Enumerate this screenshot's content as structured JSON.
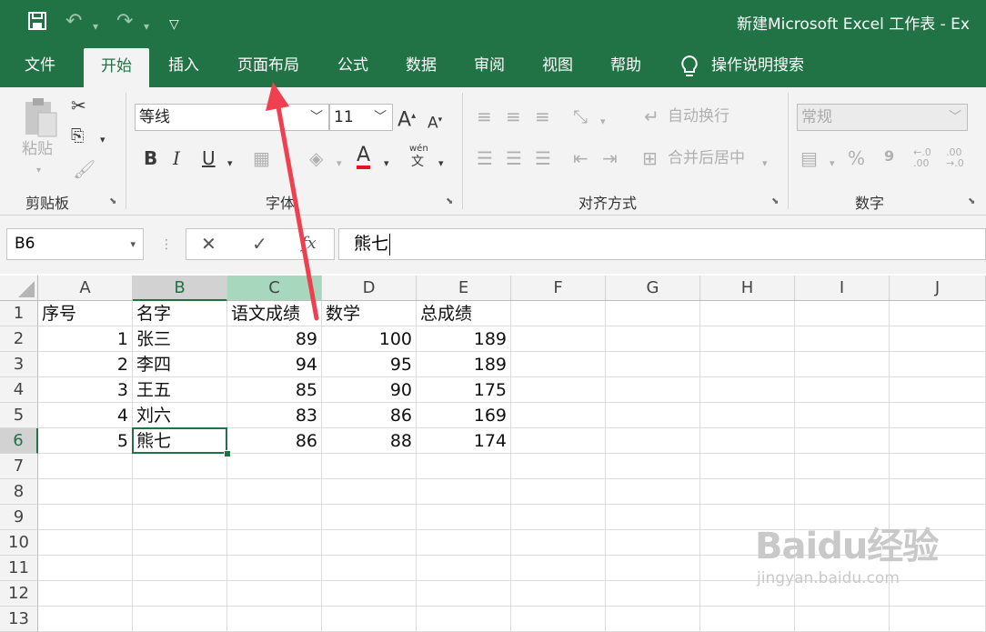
{
  "colors": {
    "accent": "#217346",
    "arrow": "#f04050"
  },
  "titlebar": {
    "save_icon": "save-icon",
    "undo_icon": "undo-icon",
    "redo_icon": "redo-icon",
    "customize_icon": "customize-quick-access-icon",
    "title": "新建Microsoft Excel 工作表  -  Ex"
  },
  "tabs": [
    {
      "label": "文件"
    },
    {
      "label": "开始",
      "active": true
    },
    {
      "label": "插入"
    },
    {
      "label": "页面布局"
    },
    {
      "label": "公式"
    },
    {
      "label": "数据"
    },
    {
      "label": "审阅"
    },
    {
      "label": "视图"
    },
    {
      "label": "帮助"
    }
  ],
  "tell_me": {
    "label": "操作说明搜索",
    "icon": "lightbulb-icon"
  },
  "ribbon": {
    "clipboard": {
      "label": "剪贴板",
      "paste": "粘贴"
    },
    "font": {
      "label": "字体",
      "font_name": "等线",
      "font_size": "11",
      "bold": "B",
      "italic": "I",
      "underline": "U",
      "font_color": "A",
      "phonetic_top": "wén",
      "phonetic_bottom": "文"
    },
    "alignment": {
      "label": "对齐方式",
      "wrap_text": "自动换行",
      "merge_center": "合并后居中"
    },
    "number": {
      "label": "数字",
      "format": "常规",
      "percent": "%",
      "comma": "9",
      "inc_decimal": "←.0\n.00",
      "dec_decimal": ".00\n→.0"
    }
  },
  "formula_bar": {
    "name_box": "B6",
    "cancel": "✕",
    "enter": "✓",
    "fx": "fx",
    "content": "熊七"
  },
  "columns": [
    "A",
    "B",
    "C",
    "D",
    "E",
    "F",
    "G",
    "H",
    "I",
    "J"
  ],
  "rows": [
    "1",
    "2",
    "3",
    "4",
    "5",
    "6",
    "7",
    "8",
    "9",
    "10",
    "11",
    "12",
    "13"
  ],
  "sheet": {
    "header": [
      "序号",
      "名字",
      "语文成绩",
      "数学",
      "总成绩"
    ],
    "records": [
      [
        "1",
        "张三",
        "89",
        "100",
        "189"
      ],
      [
        "2",
        "李四",
        "94",
        "95",
        "189"
      ],
      [
        "3",
        "王五",
        "85",
        "90",
        "175"
      ],
      [
        "4",
        "刘六",
        "83",
        "86",
        "169"
      ],
      [
        "5",
        "熊七",
        "86",
        "88",
        "174"
      ]
    ]
  },
  "selected_cell": "B6",
  "watermark": {
    "brand": "Baidu经验",
    "url": "jingyan.baidu.com"
  }
}
